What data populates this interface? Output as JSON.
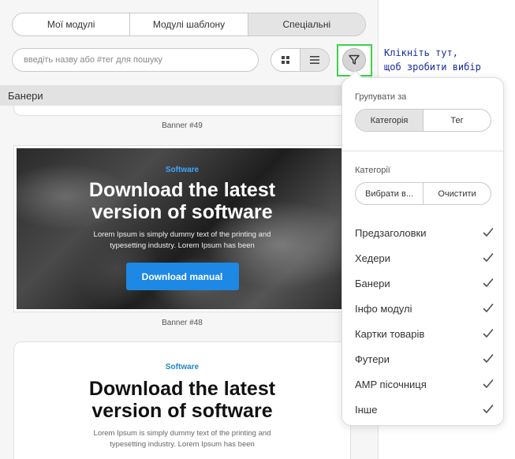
{
  "tabs": [
    {
      "label": "Мої модулі",
      "active": false
    },
    {
      "label": "Модулі шаблону",
      "active": false
    },
    {
      "label": "Спеціальні",
      "active": true
    }
  ],
  "search": {
    "placeholder": "введіть назву або #тег для пошуку"
  },
  "view": {
    "grid_icon": "grid-icon",
    "list_icon": "list-icon",
    "active": "list"
  },
  "filter": {
    "icon": "filter-icon",
    "highlight_color": "#3cd24a"
  },
  "hint": {
    "line1": "Клікніть тут,",
    "line2": "щоб зробити вибір"
  },
  "section": {
    "title": "Банери"
  },
  "banners": {
    "prev_caption": "Banner #49",
    "b48": {
      "small": "Software",
      "title": "Download the latest version of software",
      "text": "Lorem Ipsum is simply dummy text of the printing and typesetting industry. Lorem Ipsum has been",
      "button": "Download manual",
      "caption": "Banner #48"
    },
    "b47": {
      "small": "Software",
      "title": "Download the latest version of software",
      "text": "Lorem Ipsum is simply dummy text of the printing and typesetting industry. Lorem Ipsum has been"
    }
  },
  "popup": {
    "group_label": "Групувати за",
    "group_options": [
      {
        "label": "Категорія",
        "active": true
      },
      {
        "label": "Тег",
        "active": false
      }
    ],
    "cat_label": "Категорії",
    "select_all": "Вибрати в...",
    "clear": "Очистити",
    "categories": [
      {
        "label": "Предзаголовки",
        "checked": true
      },
      {
        "label": "Хедери",
        "checked": true
      },
      {
        "label": "Банери",
        "checked": true
      },
      {
        "label": "Інфо модулі",
        "checked": true
      },
      {
        "label": "Картки товарів",
        "checked": true
      },
      {
        "label": "Футери",
        "checked": true
      },
      {
        "label": "AMP пісочниця",
        "checked": true
      },
      {
        "label": "Інше",
        "checked": true
      }
    ]
  },
  "colors": {
    "accent_blue": "#1e88e5",
    "hint_text": "#1a2c9e",
    "check": "#555555"
  }
}
